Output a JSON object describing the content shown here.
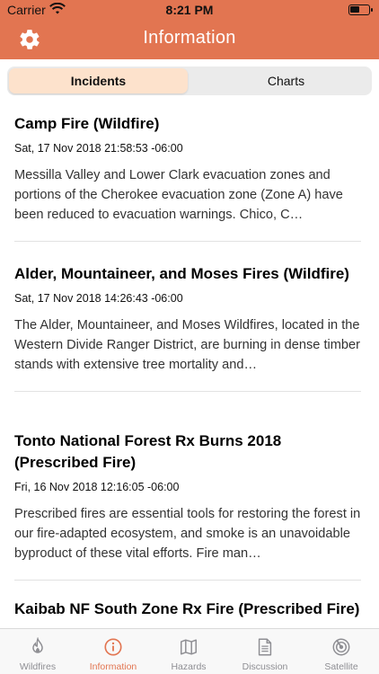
{
  "status_bar": {
    "carrier": "Carrier",
    "time": "8:21 PM"
  },
  "nav": {
    "title": "Information",
    "settings_icon": "gear-icon"
  },
  "segments": {
    "items": [
      "Incidents",
      "Charts"
    ],
    "selected": "Incidents"
  },
  "incidents": [
    {
      "title": "Camp Fire (Wildfire)",
      "date": "Sat, 17 Nov 2018 21:58:53 -06:00",
      "description": " Messilla Valley and Lower Clark evacuation zones and portions of the Cherokee evacuation zone (Zone A) have been reduced to evacuation warnings. Chico, C…"
    },
    {
      "title": "Alder, Mountaineer, and Moses Fires (Wildfire)",
      "date": "Sat, 17 Nov 2018 14:26:43 -06:00",
      "description": "The Alder, Mountaineer, and Moses Wildfires, located in the Western Divide Ranger District, are burning in dense timber stands with extensive tree mortality and…"
    },
    {
      "title": "Tonto National Forest Rx Burns 2018 (Prescribed Fire)",
      "date": "Fri, 16 Nov 2018 12:16:05 -06:00",
      "description": "Prescribed fires are essential tools for restoring the forest in our fire-adapted ecosystem, and smoke is an unavoidable byproduct of these vital efforts. Fire man…"
    },
    {
      "title": "Kaibab NF South Zone Rx Fire (Prescribed Fire)",
      "date": "",
      "description": ""
    }
  ],
  "tabs": [
    {
      "label": "Wildfires",
      "icon": "flame-icon"
    },
    {
      "label": "Information",
      "icon": "info-icon"
    },
    {
      "label": "Hazards",
      "icon": "map-icon"
    },
    {
      "label": "Discussion",
      "icon": "document-icon"
    },
    {
      "label": "Satellite",
      "icon": "satellite-icon"
    }
  ],
  "active_tab": "Information",
  "colors": {
    "accent": "#e27551",
    "segment_active": "#fde2cc",
    "inactive_tab": "#8e8e93"
  }
}
